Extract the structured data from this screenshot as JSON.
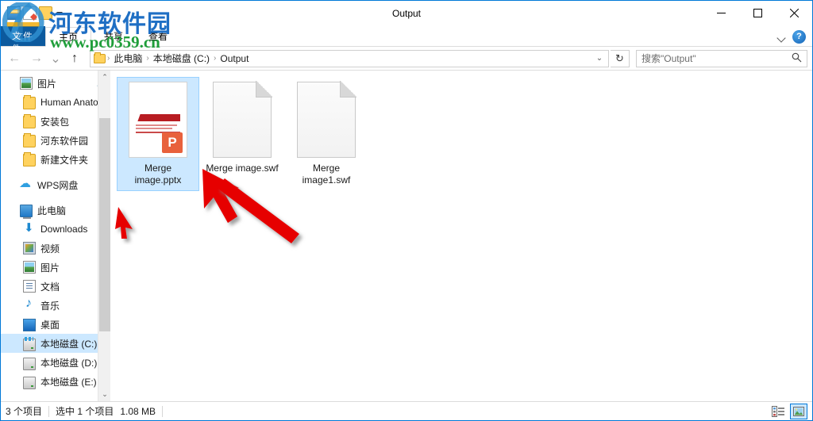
{
  "window": {
    "title": "Output",
    "controls": {
      "minimize": "—",
      "maximize": "□",
      "close": "✕"
    }
  },
  "quick_access": {
    "items": [
      "folder-window-icon",
      "properties-icon",
      "new-folder-icon"
    ],
    "dropdown": "customize-quick-access"
  },
  "ribbon": {
    "file_tab": "文件",
    "tabs": [
      {
        "label": "主页",
        "active": true
      },
      {
        "label": "共享",
        "active": false
      },
      {
        "label": "查看",
        "active": false
      }
    ],
    "collapse_icon": "chevron-down-icon",
    "help_label": "?"
  },
  "navigation": {
    "back": "←",
    "forward": "→",
    "recent": "⌄",
    "up": "↑",
    "breadcrumb": [
      "此电脑",
      "本地磁盘 (C:)",
      "Output"
    ],
    "breadcrumb_separator": "›",
    "address_dropdown": "⌄",
    "refresh": "↻"
  },
  "search": {
    "placeholder": "搜索\"Output\"",
    "icon": "search-icon"
  },
  "sidebar": {
    "groups": [
      {
        "items": [
          {
            "label": "图片",
            "icon": "picture-icon",
            "pinned": true,
            "indent": 1
          },
          {
            "label": "Human Anatom",
            "icon": "folder-icon",
            "indent": 2
          },
          {
            "label": "安装包",
            "icon": "folder-icon",
            "indent": 2
          },
          {
            "label": "河东软件园",
            "icon": "folder-icon",
            "indent": 2
          },
          {
            "label": "新建文件夹",
            "icon": "folder-icon",
            "indent": 2
          }
        ]
      },
      {
        "items": [
          {
            "label": "WPS网盘",
            "icon": "cloud-icon",
            "indent": 1
          }
        ]
      },
      {
        "items": [
          {
            "label": "此电脑",
            "icon": "computer-icon",
            "indent": 1
          },
          {
            "label": "Downloads",
            "icon": "downloads-icon",
            "indent": 2
          },
          {
            "label": "视频",
            "icon": "video-icon",
            "indent": 2
          },
          {
            "label": "图片",
            "icon": "picture-icon",
            "indent": 2
          },
          {
            "label": "文档",
            "icon": "document-icon",
            "indent": 2
          },
          {
            "label": "音乐",
            "icon": "music-icon",
            "indent": 2
          },
          {
            "label": "桌面",
            "icon": "desktop-icon",
            "indent": 2
          },
          {
            "label": "本地磁盘 (C:)",
            "icon": "drive-system-icon",
            "indent": 2,
            "selected": true
          },
          {
            "label": "本地磁盘 (D:)",
            "icon": "drive-icon",
            "indent": 2
          },
          {
            "label": "本地磁盘 (E:)",
            "icon": "drive-icon",
            "indent": 2
          }
        ]
      }
    ],
    "scrollbar": {
      "up": "⌃",
      "down": "⌄"
    }
  },
  "files": [
    {
      "name": "Merge image.pptx",
      "type": "pptx",
      "selected": true,
      "badge": "P"
    },
    {
      "name": "Merge image.swf",
      "type": "swf",
      "selected": false
    },
    {
      "name": "Merge image1.swf",
      "type": "swf",
      "selected": false
    }
  ],
  "status": {
    "item_count": "3 个项目",
    "selection": "选中 1 个项目",
    "size": "1.08 MB",
    "views": [
      {
        "name": "details-view",
        "active": false
      },
      {
        "name": "large-icons-view",
        "active": true
      }
    ]
  },
  "watermark": {
    "site_name": "河东软件园",
    "url": "www.pc0359.cn",
    "overlay_label": "文件",
    "colors": {
      "name": "#1f6fc4",
      "url": "#1f9e3a"
    }
  },
  "annotations": {
    "arrow_color": "#e60000",
    "arrows": [
      {
        "name": "arrow-to-selected-file"
      },
      {
        "name": "arrow-small-pointer"
      }
    ]
  }
}
